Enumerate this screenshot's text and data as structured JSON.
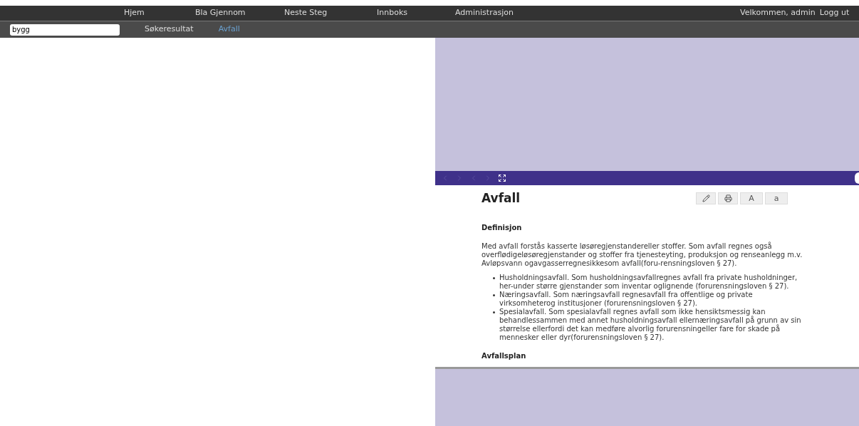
{
  "nav": {
    "items": [
      {
        "label": "Hjem"
      },
      {
        "label": "Bla Gjennom"
      },
      {
        "label": "Neste Steg"
      },
      {
        "label": "Innboks"
      },
      {
        "label": "Administrasjon"
      }
    ],
    "welcome": "Velkommen, admin",
    "logout": "Logg ut"
  },
  "search": {
    "value": "bygg"
  },
  "breadcrumbs": [
    {
      "label": "Søkeresultat",
      "selected": false
    },
    {
      "label": "Avfall",
      "selected": true
    }
  ],
  "article": {
    "title": "Avfall",
    "font_buttons": [
      "A",
      "a"
    ],
    "sections": [
      {
        "heading": "Definisjon",
        "paragraph": "Med avfall forstås kasserte løsøregjenstandereller stoffer. Som avfall regnes også overflødigeløsøregjenstander og stoffer fra tjenesteyting, produksjon og renseanlegg m.v. Avløpsvann ogavgasserregnesikkesom avfall(foru-rensningsloven § 27).",
        "bullets": [
          "Husholdningsavfall. Som husholdningsavfallregnes avfall fra private husholdninger, her-under større gjenstander som inventar oglignende (forurensningsloven § 27).",
          "Næringsavfall. Som næringsavfall regnesavfall fra offentlige og private virksomheterog institusjoner (forurensningsloven § 27).",
          "Spesialavfall. Som spesialavfall regnes avfall som ikke hensiktsmessig kan behandlessammen med annet husholdningsavfall ellernæringsavfall på grunn av sin størrelse ellerfordi det kan medføre alvorlig forurensningeller fare for skade på mennesker eller dyr(forurensningsloven § 27)."
        ]
      },
      {
        "heading": "Avfallsplan"
      }
    ]
  }
}
